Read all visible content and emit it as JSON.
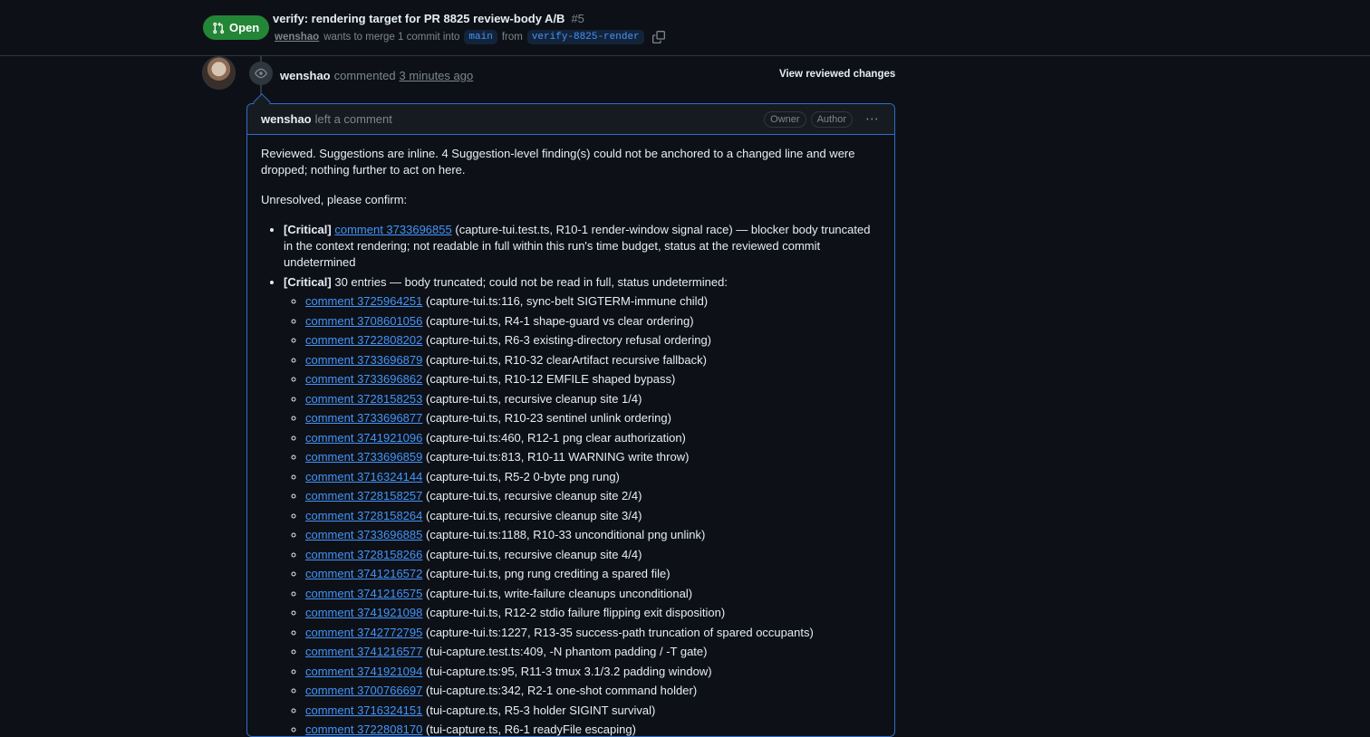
{
  "pr": {
    "state": "Open",
    "title": "verify: rendering target for PR 8825 review-body A/B",
    "number": "#5",
    "author": "wenshao",
    "merge_text": "wants to merge 1 commit into",
    "base_branch": "main",
    "from_text": "from",
    "head_branch": "verify-8825-render"
  },
  "event": {
    "author": "wenshao",
    "action": "commented",
    "time": "3 minutes ago",
    "view_reviewed_changes": "View reviewed changes"
  },
  "comment": {
    "author": "wenshao",
    "action": "left a comment",
    "roles": [
      "Owner",
      "Author"
    ],
    "menu_icon": "kebab-horizontal-icon",
    "para1": "Reviewed. Suggestions are inline. 4 Suggestion-level finding(s) could not be anchored to a changed line and were dropped; nothing further to act on here.",
    "para2": "Unresolved, please confirm:",
    "finding1": {
      "tag": "[Critical]",
      "link": "comment 3733696855",
      "text": "(capture-tui.test.ts, R10-1 render-window signal race) — blocker body truncated in the context rendering; not readable in full within this run's time budget, status at the reviewed commit undetermined"
    },
    "finding2": {
      "tag": "[Critical]",
      "text": "30 entries — body truncated; could not be read in full, status undetermined:",
      "items": [
        {
          "link": "comment 3725964251",
          "text": "(capture-tui.ts:116, sync-belt SIGTERM-immune child)"
        },
        {
          "link": "comment 3708601056",
          "text": "(capture-tui.ts, R4-1 shape-guard vs clear ordering)"
        },
        {
          "link": "comment 3722808202",
          "text": "(capture-tui.ts, R6-3 existing-directory refusal ordering)"
        },
        {
          "link": "comment 3733696879",
          "text": "(capture-tui.ts, R10-32 clearArtifact recursive fallback)"
        },
        {
          "link": "comment 3733696862",
          "text": "(capture-tui.ts, R10-12 EMFILE shaped bypass)"
        },
        {
          "link": "comment 3728158253",
          "text": "(capture-tui.ts, recursive cleanup site 1/4)"
        },
        {
          "link": "comment 3733696877",
          "text": "(capture-tui.ts, R10-23 sentinel unlink ordering)"
        },
        {
          "link": "comment 3741921096",
          "text": "(capture-tui.ts:460, R12-1 png clear authorization)"
        },
        {
          "link": "comment 3733696859",
          "text": "(capture-tui.ts:813, R10-11 WARNING write throw)"
        },
        {
          "link": "comment 3716324144",
          "text": "(capture-tui.ts, R5-2 0-byte png rung)"
        },
        {
          "link": "comment 3728158257",
          "text": "(capture-tui.ts, recursive cleanup site 2/4)"
        },
        {
          "link": "comment 3728158264",
          "text": "(capture-tui.ts, recursive cleanup site 3/4)"
        },
        {
          "link": "comment 3733696885",
          "text": "(capture-tui.ts:1188, R10-33 unconditional png unlink)"
        },
        {
          "link": "comment 3728158266",
          "text": "(capture-tui.ts, recursive cleanup site 4/4)"
        },
        {
          "link": "comment 3741216572",
          "text": "(capture-tui.ts, png rung crediting a spared file)"
        },
        {
          "link": "comment 3741216575",
          "text": "(capture-tui.ts, write-failure cleanups unconditional)"
        },
        {
          "link": "comment 3741921098",
          "text": "(capture-tui.ts, R12-2 stdio failure flipping exit disposition)"
        },
        {
          "link": "comment 3742772795",
          "text": "(capture-tui.ts:1227, R13-35 success-path truncation of spared occupants)"
        },
        {
          "link": "comment 3741216577",
          "text": "(tui-capture.test.ts:409, -N phantom padding / -T gate)"
        },
        {
          "link": "comment 3741921094",
          "text": "(tui-capture.ts:95, R11-3 tmux 3.1/3.2 padding window)"
        },
        {
          "link": "comment 3700766697",
          "text": "(tui-capture.ts:342, R2-1 one-shot command holder)"
        },
        {
          "link": "comment 3716324151",
          "text": "(tui-capture.ts, R5-3 holder SIGINT survival)"
        },
        {
          "link": "comment 3722808170",
          "text": "(tui-capture.ts, R6-1 readyFile escaping)"
        }
      ]
    }
  },
  "colors": {
    "open_badge": "#238636",
    "link": "#4493f8",
    "accent_border": "#316dca",
    "background": "#0d1117"
  },
  "icons": {
    "state": "git-pull-request-icon",
    "copy": "copy-icon",
    "review": "eye-icon"
  }
}
